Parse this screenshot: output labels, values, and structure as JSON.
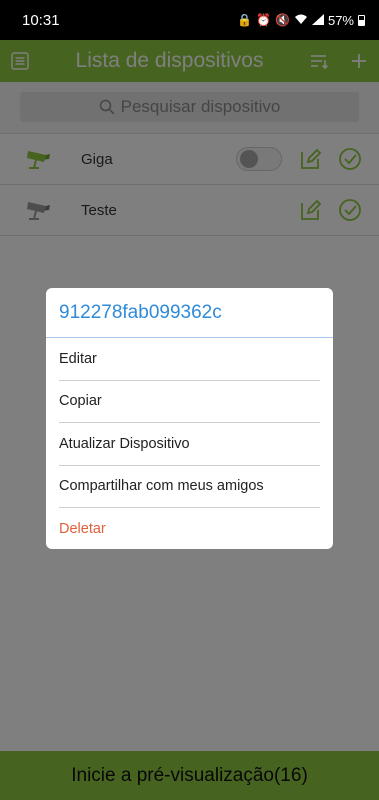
{
  "status_bar": {
    "time": "10:31",
    "battery": "57%"
  },
  "header": {
    "title": "Lista de dispositivos"
  },
  "search": {
    "placeholder": "Pesquisar dispositivo"
  },
  "devices": [
    {
      "name": "Giga"
    },
    {
      "name": "Teste"
    }
  ],
  "dialog": {
    "title": "912278fab099362c",
    "items": [
      "Editar",
      "Copiar",
      "Atualizar Dispositivo",
      "Compartilhar com meus amigos",
      "Deletar"
    ]
  },
  "bottom_bar": {
    "label": "Inicie a pré-visualização(16)"
  },
  "colors": {
    "accent": "#8cc63f",
    "link": "#2f8ad8",
    "danger": "#e0603c"
  }
}
